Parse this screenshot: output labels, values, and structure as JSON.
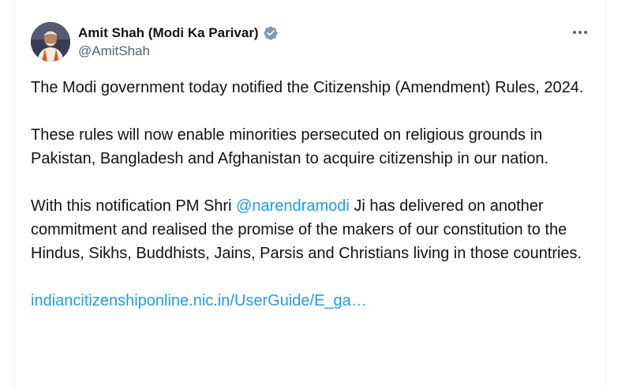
{
  "author": {
    "display_name": "Amit Shah (Modi Ka Parivar)",
    "handle": "@AmitShah",
    "verified_icon": "verified-badge-icon"
  },
  "menu": {
    "icon": "more-horizontal-icon"
  },
  "tweet": {
    "para1": "The Modi government today notified the Citizenship (Amendment) Rules, 2024.",
    "para2": "These rules will now enable minorities persecuted on religious grounds in Pakistan, Bangladesh and Afghanistan to acquire citizenship in our nation.",
    "para3_before": "With this notification PM Shri ",
    "para3_mention": "@narendramodi",
    "para3_after": " Ji has delivered on another commitment and realised the promise of the makers of our constitution to the Hindus, Sikhs, Buddhists, Jains,  Parsis and Christians living in those countries.",
    "link": "indiancitizenshiponline.nic.in/UserGuide/E_ga…"
  },
  "colors": {
    "link": "#1d9bf0",
    "text": "#0f1419",
    "muted": "#536471",
    "verified": "#829aab"
  }
}
